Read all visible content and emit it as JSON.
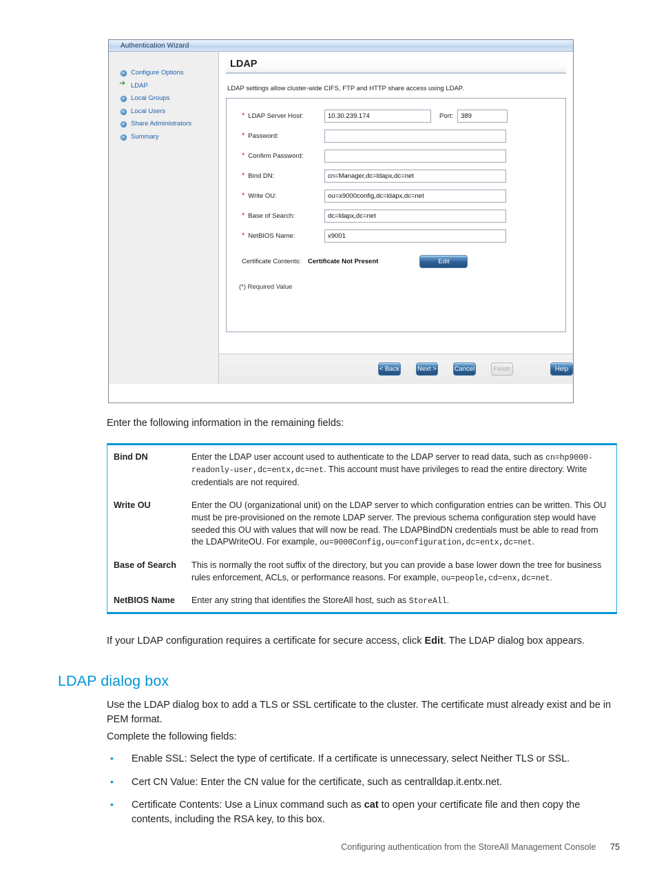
{
  "screenshot": {
    "window_title": "Authentication Wizard",
    "sidebar": {
      "items": [
        {
          "label": "Configure Options",
          "marker": "dot"
        },
        {
          "label": "LDAP",
          "marker": "arrow"
        },
        {
          "label": "Local Groups",
          "marker": "dot"
        },
        {
          "label": "Local Users",
          "marker": "dot"
        },
        {
          "label": "Share Administrators",
          "marker": "dot"
        },
        {
          "label": "Summary",
          "marker": "dot"
        }
      ]
    },
    "panel": {
      "heading": "LDAP",
      "description": "LDAP settings allow cluster-wide CIFS, FTP and HTTP share access using LDAP.",
      "fields": [
        {
          "label": "LDAP Server Host:",
          "value": "10.30.239.174",
          "required": true
        },
        {
          "label": "Password:",
          "value": "",
          "required": true
        },
        {
          "label": "Confirm Password:",
          "value": "",
          "required": true
        },
        {
          "label": "Bind DN:",
          "value": "cn=Manager,dc=ldapx,dc=net",
          "required": true
        },
        {
          "label": "Write OU:",
          "value": "ou=x9000config,dc=ldapx,dc=net",
          "required": true
        },
        {
          "label": "Base of Search:",
          "value": "dc=ldapx,dc=net",
          "required": true
        },
        {
          "label": "NetBIOS Name:",
          "value": "x9001",
          "required": true
        }
      ],
      "port_label": "Port:",
      "port_value": "389",
      "certificate_label": "Certificate Contents:",
      "certificate_status": "Certificate Not Present",
      "edit_button": "Edit",
      "required_note": "(*) Required Value"
    },
    "buttons": {
      "back": "< Back",
      "next": "Next >",
      "cancel": "Cancel",
      "finish": "Finish",
      "help": "Help"
    }
  },
  "document": {
    "lead_paragraph": "Enter the following information in the remaining fields:",
    "table": [
      {
        "term": "Bind DN",
        "parts": [
          {
            "t": "Enter the LDAP user account used to authenticate to the LDAP server to read data, such as ",
            "s": "n"
          },
          {
            "t": "cn=hp9000-readonly-user,dc=entx,dc=net",
            "s": "m"
          },
          {
            "t": ". This account must have privileges to read the entire directory. Write credentials are not required.",
            "s": "n"
          }
        ]
      },
      {
        "term": "Write OU",
        "parts": [
          {
            "t": "Enter the OU (organizational unit) on the LDAP server to which configuration entries can be written. This OU must be pre-provisioned on the remote LDAP server. The previous schema configuration step would have seeded this OU with values that will now be read. The LDAPBindDN credentials must be able to read from the LDAPWriteOU. For example, ",
            "s": "n"
          },
          {
            "t": "ou=9000Config,ou=configuration,dc=entx,dc=net",
            "s": "m"
          },
          {
            "t": ".",
            "s": "n"
          }
        ]
      },
      {
        "term": "Base of Search",
        "parts": [
          {
            "t": "This is normally the root suffix of the directory, but you can provide a base lower down the tree for business rules enforcement, ACLs, or performance reasons. For example, ",
            "s": "n"
          },
          {
            "t": "ou=people,cd=enx,dc=net",
            "s": "m"
          },
          {
            "t": ".",
            "s": "n"
          }
        ]
      },
      {
        "term": "NetBIOS Name",
        "parts": [
          {
            "t": "Enter any string that identifies the StoreAll host, such as ",
            "s": "n"
          },
          {
            "t": "StoreAll",
            "s": "m"
          },
          {
            "t": ".",
            "s": "n"
          }
        ]
      }
    ],
    "certificate_paragraph": [
      {
        "t": "If your LDAP configuration requires a certificate for secure access, click ",
        "s": "n"
      },
      {
        "t": "Edit",
        "s": "b"
      },
      {
        "t": ". The LDAP dialog box appears.",
        "s": "n"
      }
    ],
    "section_heading": "LDAP dialog box",
    "use_paragraph": "Use the LDAP dialog box to add a TLS or SSL certificate to the cluster. The certificate must already exist and be in PEM format.",
    "complete_paragraph": "Complete the following fields:",
    "bullets": [
      [
        {
          "t": "Enable SSL: Select the type of certificate. If a certificate is unnecessary, select Neither TLS or SSL.",
          "s": "n"
        }
      ],
      [
        {
          "t": "Cert CN Value: Enter the CN value for the certificate, such as centralldap.it.entx.net.",
          "s": "n"
        }
      ],
      [
        {
          "t": "Certificate Contents: Use a Linux command such as ",
          "s": "n"
        },
        {
          "t": "cat",
          "s": "b"
        },
        {
          "t": " to open your certificate file and then copy the contents, including the RSA key, to this box.",
          "s": "n"
        }
      ]
    ],
    "bullet_marker": "•",
    "footer_text": "Configuring authentication from the StoreAll Management Console",
    "page_number": "75"
  },
  "colors": {
    "hp_blue": "#0096d6",
    "link_blue": "#1c5fab",
    "required_red": "#e02020",
    "arrow_green": "#3aa03a"
  }
}
